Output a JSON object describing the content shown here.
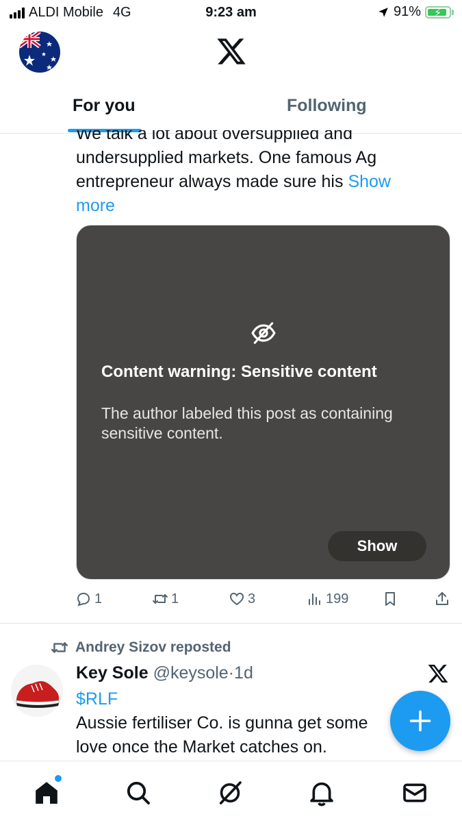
{
  "status_bar": {
    "carrier": "ALDI Mobile",
    "network": "4G",
    "time": "9:23 am",
    "battery": "91%",
    "battery_level": 0.91
  },
  "header": {
    "tabs": [
      {
        "label": "For you",
        "active": true
      },
      {
        "label": "Following",
        "active": false
      }
    ]
  },
  "tweet1": {
    "cut_line": "We talk a lot about oversupplied and",
    "lines": [
      "undersupplied markets. One famous Ag",
      "entrepreneur always made sure his "
    ],
    "show_more_1": "Show",
    "show_more_2": "more",
    "warning": {
      "title": "Content warning: Sensitive content",
      "body": "The author labeled this post as containing sensitive content.",
      "show_label": "Show"
    },
    "actions": {
      "replies": "1",
      "reposts": "1",
      "likes": "3",
      "views": "199"
    }
  },
  "tweet2": {
    "repost_label": "Andrey Sizov reposted",
    "name": "Key Sole",
    "handle": "@keysole",
    "separator": "·",
    "age": "1d",
    "cashtag": "$RLF",
    "body_line1": "Aussie fertiliser Co. is gunna get some",
    "body_line2": "love once the Market catches on."
  },
  "colors": {
    "accent": "#1d9bf0",
    "secondary_text": "#536471",
    "media_bg": "#474644"
  },
  "icons": {
    "nav": [
      "home-icon",
      "search-icon",
      "grok-icon",
      "notifications-icon",
      "messages-icon"
    ],
    "compose": "plus-icon"
  }
}
